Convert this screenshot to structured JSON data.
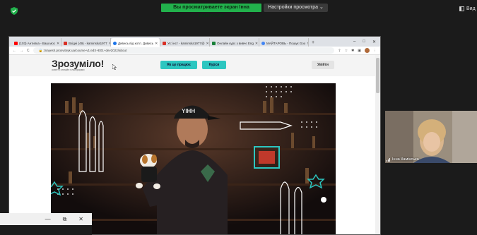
{
  "meeting": {
    "share_banner": "Вы просматриваете экран Інна Камінська",
    "view_settings": "Настройки просмотра ⌄",
    "view_button": "Вид"
  },
  "browser": {
    "tabs": [
      {
        "label": "(103) Антипка - Ваш мос",
        "icon_color": "#ff0000"
      },
      {
        "label": "Вхідні (49) - kaminska1977",
        "icon_color": "#d93025"
      },
      {
        "label": "Дивись від котл. Дивись",
        "icon_color": "#1a73e8"
      },
      {
        "label": "Ук: інст - kaminska1977@",
        "icon_color": "#d93025"
      },
      {
        "label": "Онлайн курс з вивчє Eng",
        "icon_color": "#188038"
      },
      {
        "label": "МАЙТАРОВЬ - Пошук Goo",
        "icon_color": "#4285f4"
      }
    ],
    "address": "znayesh.prosvitnyk.ua/course-v1:edX+E01+dev2022/about",
    "window_controls": [
      "–",
      "□",
      "✕"
    ]
  },
  "site": {
    "logo": "Зрозуміло!",
    "logo_subtitle": "освітні онлайн платформи",
    "nav": [
      "Як це працює",
      "Курси"
    ],
    "login": "Увійти"
  },
  "webcam": {
    "name": "Інна Камінська"
  },
  "popup_controls": [
    "—",
    "⧉",
    "✕"
  ]
}
